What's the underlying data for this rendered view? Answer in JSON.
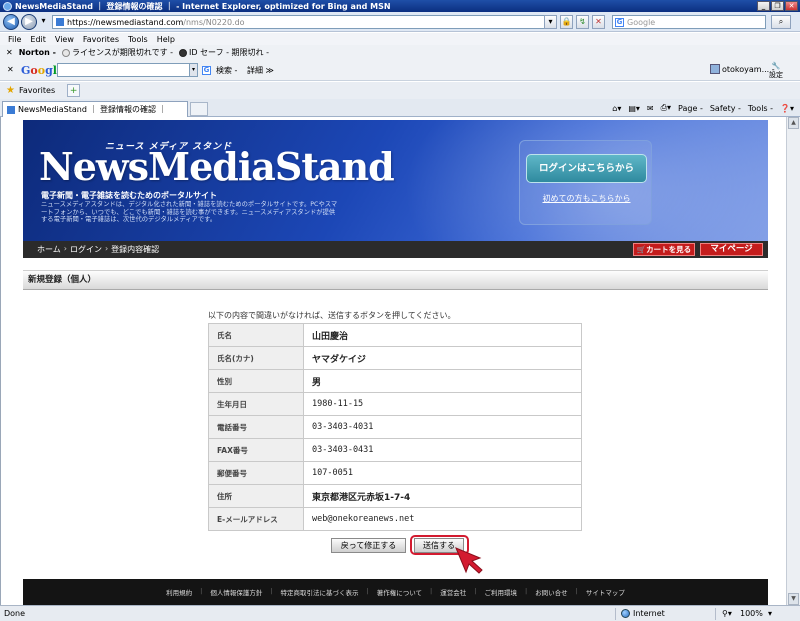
{
  "window": {
    "title": "NewsMediaStand ｜ 登録情報の確認 ｜ - Internet Explorer, optimized for Bing and MSN",
    "controls": [
      "_",
      "❐",
      "✕"
    ]
  },
  "address": {
    "url_host": "https://newsmediastand.com",
    "url_path": "/nms/N0220.do",
    "search_placeholder": "Google"
  },
  "menu": [
    "File",
    "Edit",
    "View",
    "Favorites",
    "Tools",
    "Help"
  ],
  "norton": {
    "brand": "Norton -",
    "item1": "ライセンスが期限切れです -",
    "item2": "ID セーフ - 期限切れ -"
  },
  "google_toolbar": {
    "search_btn": "検索 -",
    "more": "詳細 ≫",
    "user": "otokoyam... -",
    "settings": "設定"
  },
  "favorites": {
    "label": "Favorites"
  },
  "tab": {
    "title": "NewsMediaStand ｜ 登録情報の確認 ｜"
  },
  "command_bar": [
    "Page -",
    "Safety -",
    "Tools -"
  ],
  "banner": {
    "brand_kana": "ニュース メディア スタンド",
    "brand_name": "NewsMediaStand",
    "tagline": "電子新聞・電子雑誌を読むためのポータルサイト",
    "description": "ニュースメディアスタンドは、デジタル化された新聞・雑誌を読むためのポータルサイトです。PCやスマートフォンから、いつでも、どこでも新聞・雑誌を読む事ができます。ニュースメディアスタンドが提供する電子新聞・電子雑誌は、次世代のデジタルメディアです。",
    "login_button": "ログインはこちらから",
    "first_time_link": "初めての方もこちらから"
  },
  "navbar": {
    "breadcrumbs": [
      "ホーム",
      "ログイン",
      "登録内容確認"
    ],
    "cart_button": "カートを見る",
    "mypage_button": "マイページ"
  },
  "section_title": "新規登録（個人）",
  "instruction": "以下の内容で間違いがなければ、送信するボタンを押してください。",
  "form_rows": [
    {
      "label": "氏名",
      "value": "山田慶治"
    },
    {
      "label": "氏名(カナ)",
      "value": "ヤマダケイジ"
    },
    {
      "label": "性別",
      "value": "男"
    },
    {
      "label": "生年月日",
      "value": "1980-11-15"
    },
    {
      "label": "電話番号",
      "value": "03-3403-4031"
    },
    {
      "label": "FAX番号",
      "value": "03-3403-0431"
    },
    {
      "label": "郵便番号",
      "value": "107-0051"
    },
    {
      "label": "住所",
      "value": "東京都港区元赤坂1-7-4"
    },
    {
      "label": "E-メールアドレス",
      "value": "web@onekoreanews.net"
    }
  ],
  "buttons": {
    "back": "戻って修正する",
    "submit": "送信する"
  },
  "footer_links": [
    "利用規約",
    "個人情報保護方針",
    "特定商取引法に基づく表示",
    "著作権について",
    "運営会社",
    "ご利用環境",
    "お問い合せ",
    "サイトマップ"
  ],
  "status": {
    "text": "Done",
    "zone": "Internet",
    "zoom": "100%"
  },
  "colors": {
    "titlebar": "#0b2f80",
    "banner_blue": "#1c47b6",
    "nav_dark": "#2b2b2b",
    "red_button": "#c41c1c",
    "highlight_red": "#d31b30"
  }
}
